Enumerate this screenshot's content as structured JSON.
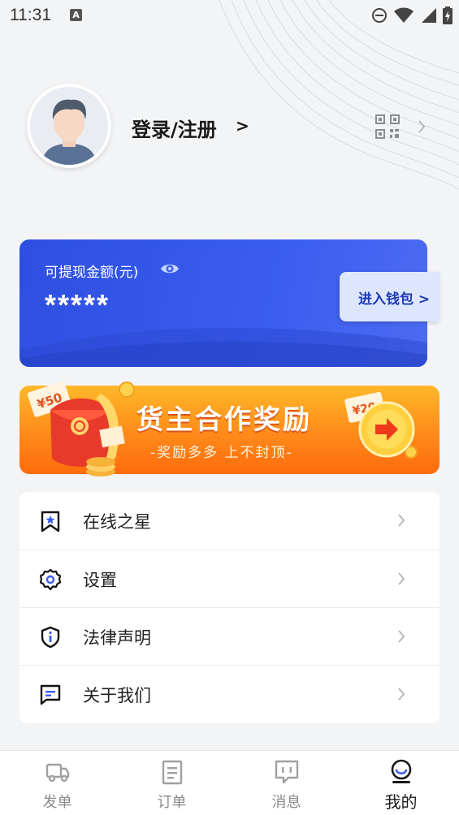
{
  "status_bar": {
    "time": "11:31",
    "a_badge": "A",
    "icons": [
      "dnd-icon",
      "wifi-icon",
      "signal-icon",
      "battery-icon"
    ]
  },
  "profile": {
    "login_label": "登录/注册",
    "login_arrow": ">",
    "icons": [
      "avatar-icon",
      "qr-code-icon",
      "chevron-right-icon"
    ]
  },
  "wallet": {
    "label": "可提现金额(元)",
    "amount": "*****",
    "enter_label": "进入钱包 >",
    "accent": "#3a5df0"
  },
  "banner": {
    "title": "货主合作奖励",
    "subtitle": "-奖励多多  上不封顶-",
    "coin_left": "¥50",
    "coin_right": "¥20"
  },
  "menu": {
    "items": [
      {
        "label": "在线之星",
        "icon": "bookmark-star-icon"
      },
      {
        "label": "设置",
        "icon": "gear-icon"
      },
      {
        "label": "法律声明",
        "icon": "shield-info-icon"
      },
      {
        "label": "关于我们",
        "icon": "message-icon"
      }
    ]
  },
  "bottom_nav": {
    "items": [
      {
        "label": "发单",
        "icon": "truck-icon",
        "active": false
      },
      {
        "label": "订单",
        "icon": "document-icon",
        "active": false
      },
      {
        "label": "消息",
        "icon": "chat-icon",
        "active": false
      },
      {
        "label": "我的",
        "icon": "profile-icon",
        "active": true
      }
    ]
  }
}
